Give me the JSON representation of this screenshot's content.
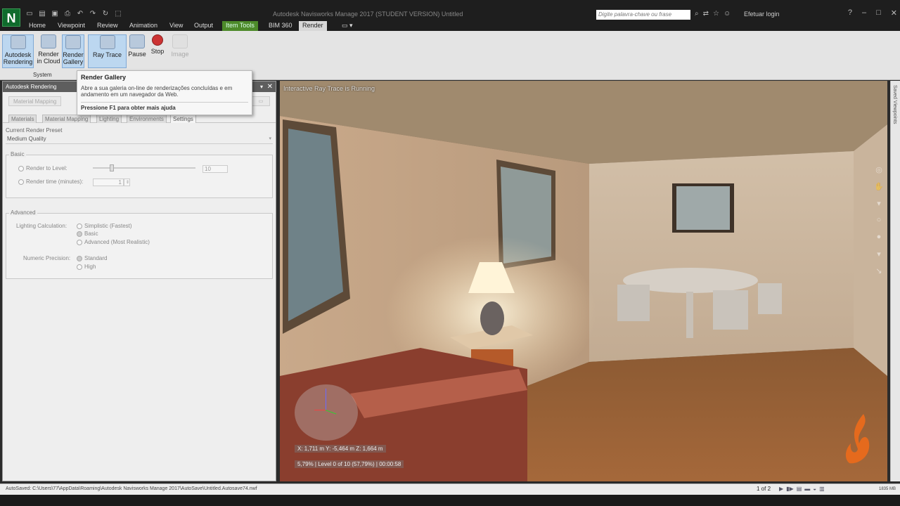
{
  "app": {
    "logo_letter": "N",
    "title": "Autodesk Navisworks Manage 2017 (STUDENT VERSION)   Untitled",
    "search_placeholder": "Digite palavra-chave ou frase",
    "login": "Efetuar login"
  },
  "tabs": [
    {
      "label": "Home"
    },
    {
      "label": "Viewpoint"
    },
    {
      "label": "Review"
    },
    {
      "label": "Animation"
    },
    {
      "label": "View"
    },
    {
      "label": "Output"
    },
    {
      "label": "Item Tools"
    },
    {
      "label": "BIM 360"
    },
    {
      "label": "Render"
    }
  ],
  "ribbon": {
    "autodesk_rendering": "Autodesk Rendering",
    "render_in_cloud": "Render in Cloud",
    "render_gallery": "Render Gallery",
    "ray_trace": "Ray Trace",
    "pause": "Pause",
    "stop": "Stop",
    "image": "Image",
    "group_system": "System"
  },
  "tooltip": {
    "title": "Render Gallery",
    "body": "Abre a sua galeria on-line de renderizações concluídas e em andamento em um navegador da Web.",
    "help": "Pressione F1 para obter mais ajuda"
  },
  "panel": {
    "title": "Autodesk Rendering",
    "material_mapping_btn": "Material Mapping",
    "subtabs": [
      {
        "label": "Materials"
      },
      {
        "label": "Material Mapping"
      },
      {
        "label": "Lighting"
      },
      {
        "label": "Environments"
      },
      {
        "label": "Settings"
      }
    ],
    "current_render_preset_label": "Current Render Preset",
    "current_render_preset_value": "Medium Quality",
    "basic": {
      "label": "Basic",
      "render_to_level": "Render to Level:",
      "render_to_level_value": "10",
      "render_time": "Render time (minutes):",
      "render_time_value": "1"
    },
    "advanced": {
      "label": "Advanced",
      "lighting_calc": "Lighting Calculation:",
      "lighting_options": [
        "Simplistic (Fastest)",
        "Basic",
        "Advanced (Most Realistic)"
      ],
      "numeric_precision": "Numeric Precision:",
      "precision_options": [
        "Standard",
        "High"
      ]
    }
  },
  "viewport": {
    "status": "Interactive Ray Trace is Running",
    "coordinates": "X: 1,711 m  Y: -5,464 m  Z: 1,664 m",
    "progress": "5,79% | Level 0 of 10 (57,79%) | 00:00:58",
    "saved_viewpoints": "Saved Viewpoints"
  },
  "statusbar": {
    "autosave": "AutoSaved: C:\\Users\\77\\AppData\\Roaming\\Autodesk Navisworks Manage 2017\\AutoSave\\Untitled.Autosave74.nwf",
    "pager": "1 of 2",
    "memory": "1835 MB"
  }
}
